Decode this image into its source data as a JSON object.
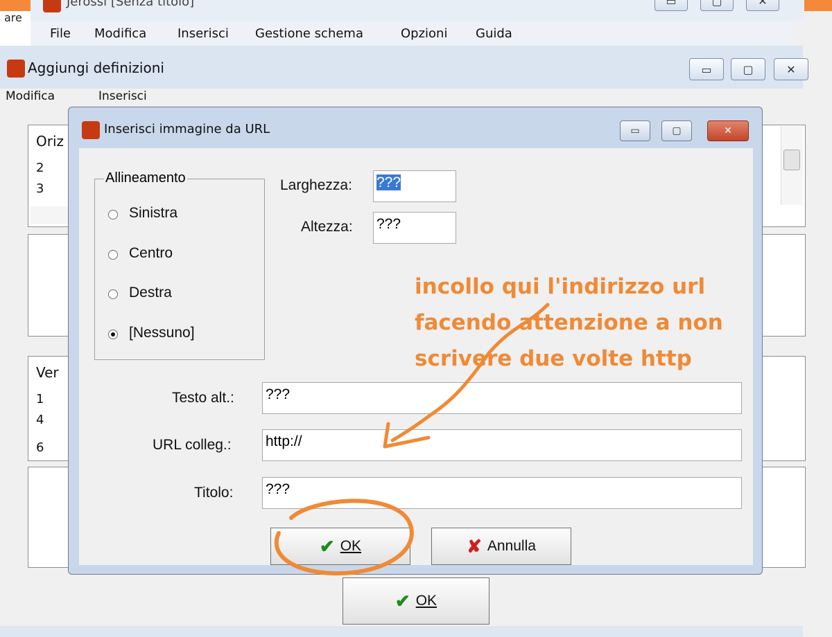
{
  "bg_window": {
    "title": "Jerossi [Senza titolo]",
    "left_text": "are",
    "menu": [
      "File",
      "Modifica",
      "Inserisci",
      "Gestione schema",
      "Opzioni",
      "Guida"
    ]
  },
  "window": {
    "title": "Aggiungi definizioni",
    "menu": [
      "Modifica",
      "Inserisci"
    ],
    "list1": {
      "header": "Oriz",
      "rows": [
        "2",
        "3"
      ]
    },
    "list2": {
      "header": "Ver",
      "rows": [
        "1",
        "4",
        "6"
      ]
    },
    "ok_label": "OK"
  },
  "dialog": {
    "title": "Inserisci immagine da URL",
    "alignment": {
      "label": "Allineamento",
      "options": [
        "Sinistra",
        "Centro",
        "Destra",
        "[Nessuno]"
      ],
      "selected": "[Nessuno]"
    },
    "fields": {
      "width": {
        "label": "Larghezza:",
        "value": "???"
      },
      "height": {
        "label": "Altezza:",
        "value": "???"
      },
      "alt_text": {
        "label": "Testo alt.:",
        "value": "???"
      },
      "link_url": {
        "label": "URL colleg.:",
        "value": "http://"
      },
      "title": {
        "label": "Titolo:",
        "value": "???"
      }
    },
    "ok_label": "OK",
    "cancel_label": "Annulla"
  },
  "annotation": {
    "text": "incollo qui l'indirizzo url facendo attenzione a non scrivere due volte http",
    "color": "#f08a36"
  },
  "colors": {
    "accent": "#3a79d4",
    "annotation": "#f08a36",
    "close_button": "#c1462b"
  }
}
